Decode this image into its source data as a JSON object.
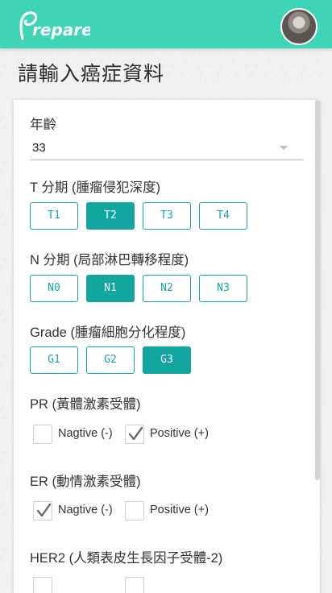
{
  "app": {
    "logo_text": "Prepare"
  },
  "page_title": "請輸入癌症資料",
  "form": {
    "age": {
      "label": "年齡",
      "value": "33"
    },
    "t_stage": {
      "label": "T 分期 (腫瘤侵犯深度)",
      "options": [
        "T1",
        "T2",
        "T3",
        "T4"
      ],
      "selected": "T2"
    },
    "n_stage": {
      "label": "N 分期 (局部淋巴轉移程度)",
      "options": [
        "N0",
        "N1",
        "N2",
        "N3"
      ],
      "selected": "N1"
    },
    "grade": {
      "label": "Grade (腫瘤細胞分化程度)",
      "options": [
        "G1",
        "G2",
        "G3"
      ],
      "selected": "G3"
    },
    "pr": {
      "label": "PR (黃體激素受體)",
      "negative": {
        "label": "Nagtive (-)",
        "checked": false
      },
      "positive": {
        "label": "Positive (+)",
        "checked": true
      }
    },
    "er": {
      "label": "ER (動情激素受體)",
      "negative": {
        "label": "Nagtive (-)",
        "checked": true
      },
      "positive": {
        "label": "Positive (+)",
        "checked": false
      }
    },
    "her2": {
      "label": "HER2 (人類表皮生長因子受體-2)"
    }
  },
  "colors": {
    "appbar": "#3fd4b6",
    "accent": "#13a5a0"
  }
}
